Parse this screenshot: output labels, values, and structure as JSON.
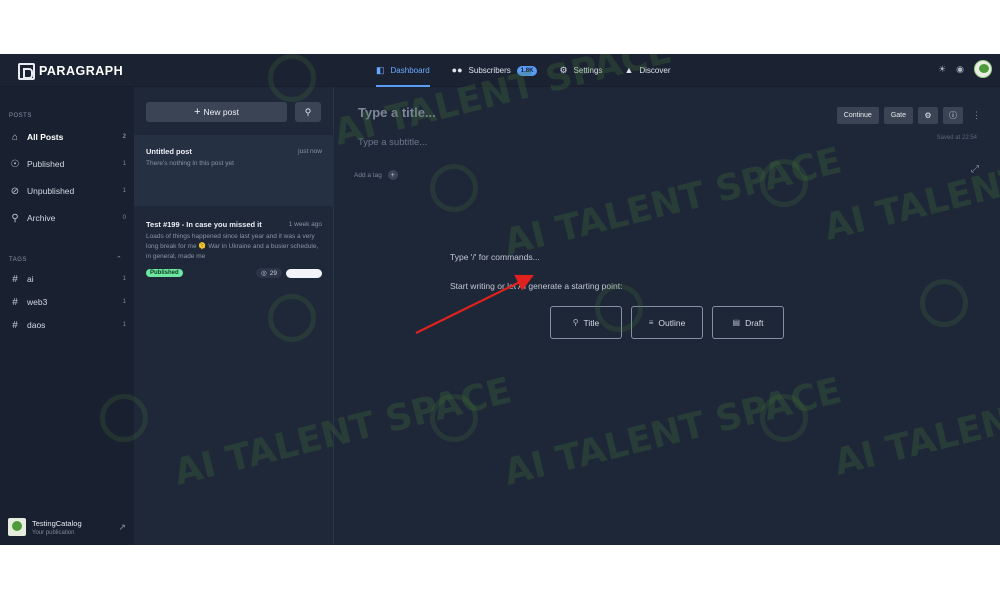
{
  "app": {
    "logo_text": "PARAGRAPH"
  },
  "nav": {
    "items": [
      {
        "label": "Dashboard",
        "icon": "dashboard-icon"
      },
      {
        "label": "Subscribers",
        "icon": "users-icon",
        "badge": "1.8K"
      },
      {
        "label": "Settings",
        "icon": "gear-icon"
      },
      {
        "label": "Discover",
        "icon": "flame-icon"
      }
    ]
  },
  "sidebar": {
    "posts_heading": "POSTS",
    "items": [
      {
        "label": "All Posts",
        "count": "2",
        "icon": "home-icon"
      },
      {
        "label": "Published",
        "count": "1",
        "icon": "globe-icon"
      },
      {
        "label": "Unpublished",
        "count": "1",
        "icon": "eye-off-icon"
      },
      {
        "label": "Archive",
        "count": "0",
        "icon": "archive-icon"
      }
    ],
    "tags_heading": "TAGS",
    "tags": [
      {
        "label": "ai",
        "count": "1"
      },
      {
        "label": "web3",
        "count": "1"
      },
      {
        "label": "daos",
        "count": "1"
      }
    ],
    "profile": {
      "name": "TestingCatalog",
      "subtitle": "Your publication"
    }
  },
  "postlist": {
    "new_post_label": "New post",
    "posts": [
      {
        "title": "Untitled post",
        "time": "just now",
        "excerpt": "There's nothing in this post yet"
      },
      {
        "title": "Test #199 - In case you missed it",
        "time": "1 week ago",
        "excerpt": "Loads of things happened since last year and it was a very long break for me 🫠 War in Ukraine and a busier schedule, in general, made me",
        "status": "Published",
        "views": "29"
      }
    ]
  },
  "editor": {
    "title_placeholder": "Type a title...",
    "subtitle_placeholder": "Type a subtitle...",
    "add_tag_label": "Add a tag",
    "continue_label": "Continue",
    "gate_label": "Gate",
    "saved_text": "Saved at 22:54",
    "command_hint": "Type '/' for commands...",
    "ai_hint": "Start writing or let AI generate a starting point:",
    "ai_buttons": [
      {
        "label": "Title",
        "icon": "lightbulb-icon"
      },
      {
        "label": "Outline",
        "icon": "list-icon"
      },
      {
        "label": "Draft",
        "icon": "document-icon"
      }
    ]
  },
  "watermark": {
    "text": "AI TALENT SPACE"
  },
  "colors": {
    "accent": "#5b9cf5",
    "published": "#6ee7a0",
    "background": "#1e2738",
    "annotation_arrow": "#e0211d"
  }
}
